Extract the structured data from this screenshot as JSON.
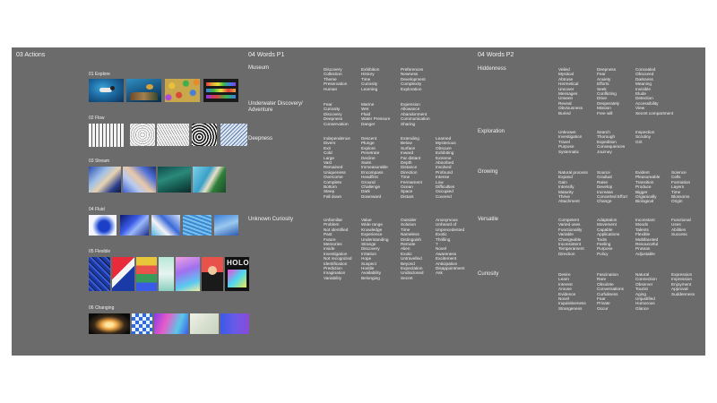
{
  "colors": {
    "board": "#6b6b6b",
    "page": "#ffffff",
    "text": "#f2f2f2"
  },
  "actions": {
    "title": "03  Actions",
    "sections": [
      {
        "label": "01 Explore",
        "thumbs": [
          "underwater-diver-image",
          "coral-reef-image",
          "colorful-stones-image",
          "color-swatches-image"
        ]
      },
      {
        "label": "02 Flow",
        "thumbs": [
          "maze-pattern-image",
          "topographic-lines-image",
          "flowing-lines-image",
          "swirl-pattern-image",
          "wave-pattern-image"
        ]
      },
      {
        "label": "03 Stream",
        "thumbs": [
          "marbled-paint-image",
          "fluid-art-image",
          "river-aerial-image",
          "ocean-coast-image"
        ]
      },
      {
        "label": "04 Fluid",
        "thumbs": [
          "ink-splash-image",
          "fluid-gradient-image",
          "swirl-paint-image",
          "water-texture-image",
          "blue-texture-image"
        ]
      },
      {
        "label": "05 Flexible",
        "thumbs": [
          "poster-blue-image",
          "poster-red-image",
          "poster-colorful-image",
          "poster-mint-image",
          "poster-gradient-image",
          "poster-face-image",
          "poster-holo-image"
        ]
      },
      {
        "label": "06 Changing",
        "thumbs": [
          "light-streak-image",
          "blue-tiles-image",
          "gradient-blur-image",
          "soft-texture-image",
          "blue-purple-gradient-image"
        ]
      }
    ],
    "holo_text": "HOLO"
  },
  "words_p1": {
    "title": "04  Words P1",
    "categories": [
      {
        "name": "Museum",
        "columns": [
          [
            "Discovery",
            "Collection",
            "Theme",
            "Preservation",
            "Human"
          ],
          [
            "Exhibition",
            "History",
            "Time",
            "Curiosity",
            "Learning"
          ],
          [
            "Preferences",
            "Newness",
            "Development",
            "Complexity",
            "Exploration"
          ]
        ]
      },
      {
        "name": "Underwater Discovery/ Adventure",
        "columns": [
          [
            "Fear",
            "Curiosity",
            "Discovery",
            "Deepness",
            "Conservation"
          ],
          [
            "Marine",
            "Wet",
            "Fluid",
            "Water Pressure",
            "Danger"
          ],
          [
            "Expension",
            "Allowance",
            "Abandonment",
            "Communication",
            "Sharing"
          ]
        ]
      },
      {
        "name": "Deepness",
        "columns": [
          [
            "Independence",
            "Divers",
            "Exit",
            "Cold",
            "Large",
            "Vast",
            "Remained",
            "Uniqueness",
            "Overcome",
            "Complete",
            "Bottom",
            "Steep",
            "Fall down"
          ],
          [
            "Descent",
            "Plunge",
            "Explore",
            "Penetrate",
            "Decline",
            "Swim",
            "Immeasurable",
            "Encompass",
            "Headfirst",
            "Ground",
            "Challenge",
            "Dark",
            "Downward"
          ],
          [
            "Extending",
            "Below",
            "Surface",
            "Inward",
            "Far distant",
            "Depth",
            "Distance",
            "Direction",
            "Time",
            "Fermament",
            "Ocean",
            "Space",
            "Distant"
          ],
          [
            "Learned",
            "Mysterious",
            "Obscure",
            "Exhibiting",
            "Extreme",
            "Absorbed",
            "Involved",
            "Profound",
            "Intense",
            "Low",
            "Difficulties",
            "Occupied",
            "Covered"
          ]
        ]
      },
      {
        "name": "Unknown Curiosity",
        "columns": [
          [
            "Unfamiliar",
            "Problem",
            "Not identified",
            "Past",
            "Future",
            "Memories",
            "Inside",
            "Investigation",
            "Not recognized",
            "Identification",
            "Prediction",
            "Imagination",
            "Variability"
          ],
          [
            "Value",
            "Wide range",
            "Knowledge",
            "Experience",
            "Understanding",
            "Strange",
            "Discovery",
            "Irritation",
            "Hope",
            "Suspect",
            "Hostile",
            "Availability",
            "Belonging"
          ],
          [
            "Outsider",
            "Solution",
            "Time",
            "Nameless",
            "Distinguish",
            "Remote",
            "Alien",
            "Exotic",
            "Untravelled",
            "Beyond",
            "Expectation",
            "Undisclosed",
            "Secret"
          ],
          [
            "Anonymous",
            "Unheard of",
            "Unprecedented",
            "Exotic",
            "Thrilling",
            "?",
            "Novel",
            "Awareness",
            "Excitement",
            "Anticipation",
            "Disappointment",
            "Ask"
          ]
        ]
      }
    ]
  },
  "words_p2": {
    "title": "04  Words P2",
    "categories": [
      {
        "name": "Hiddenness",
        "columns": [
          [
            "Veiled",
            "Mystical",
            "Abtruse",
            "Hermetical",
            "Uncover",
            "Messages",
            "Unseen",
            "Reveal",
            "Obviousness",
            "Buried"
          ],
          [
            "Deepness",
            "Fear",
            "Anxiety",
            "Efforts",
            "Seek",
            "Conflicting",
            "Drive",
            "Desperately",
            "Mission",
            "Free will"
          ],
          [
            "Concealed",
            "Obscured",
            "Darkness",
            "Meaning",
            "Invisible",
            "Elude",
            "Detection",
            "Accessibility",
            "View",
            "Secret compartment"
          ]
        ]
      },
      {
        "name": "Exploration",
        "columns": [
          [
            "Unknown",
            "Investigation",
            "Travel",
            "Purpose",
            "Systematic"
          ],
          [
            "Search",
            "Thorough",
            "Expedition",
            "Consequences",
            "Journey"
          ],
          [
            "Inspection",
            "Scrutiny",
            "Grit"
          ]
        ]
      },
      {
        "name": "Growing",
        "columns": [
          [
            "Natural process",
            "Expand",
            "Gain",
            "Intensify",
            "Maturity",
            "Thrive",
            "Attachment"
          ],
          [
            "Source",
            "Gradual",
            "Raise",
            "Develop",
            "Increase",
            "Concerted Effort",
            "Change"
          ],
          [
            "Evident",
            "Pleasureable",
            "Transition",
            "Produce",
            "Bigger",
            "Organically",
            "Biological"
          ],
          [
            "Science",
            "Cells",
            "Formation",
            "Layers",
            "Time",
            "Blossoms",
            "Origin"
          ]
        ]
      },
      {
        "name": "Versatile",
        "columns": [
          [
            "Competent",
            "Varied uses",
            "Functionality",
            "Variable",
            "Changeable",
            "Inconsistent",
            "Temperament",
            "Direction"
          ],
          [
            "Adaptation",
            "Movement",
            "Capable",
            "Applications",
            "Tools",
            "Feeling",
            "Purpose",
            "Policy"
          ],
          [
            "Inconstant",
            "Moods",
            "Talents",
            "Flexible",
            "Multifaceted",
            "Resourceful",
            "Protean",
            "Adjustable"
          ],
          [
            "Functional",
            "Uses",
            "Abilities",
            "Success"
          ]
        ]
      },
      {
        "name": "Curiosity",
        "columns": [
          [
            "Desire",
            "Learn",
            "Interest",
            "Arouse",
            "Evidence",
            "Novel",
            "Inquisitiveness",
            "Strangeness"
          ],
          [
            "Fascination",
            "Rare",
            "Obsolete",
            "Conversations",
            "Curfuliness",
            "Fear",
            "Private",
            "Occur"
          ],
          [
            "Natural",
            "Connection",
            "Observer",
            "Tourist",
            "Aging",
            "Unjustified",
            "Humorous",
            "Glance"
          ],
          [
            "Expression",
            "Impression",
            "Enjoyment",
            "Approval",
            "Suddenness"
          ]
        ]
      }
    ]
  }
}
